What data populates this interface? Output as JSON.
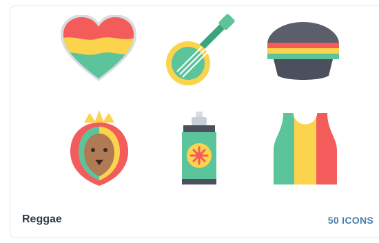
{
  "pack": {
    "name": "Reggae",
    "count_label": "50 ICONS"
  },
  "icons": [
    {
      "name": "heart-icon"
    },
    {
      "name": "banjo-icon"
    },
    {
      "name": "rasta-hat-icon"
    },
    {
      "name": "lion-icon"
    },
    {
      "name": "spray-can-icon"
    },
    {
      "name": "tank-top-icon"
    }
  ],
  "palette": {
    "red": "#f45c5c",
    "yellow": "#fbd34d",
    "green": "#5cc49a",
    "dark": "#4c4f5c",
    "outline": "#d8dde3"
  }
}
